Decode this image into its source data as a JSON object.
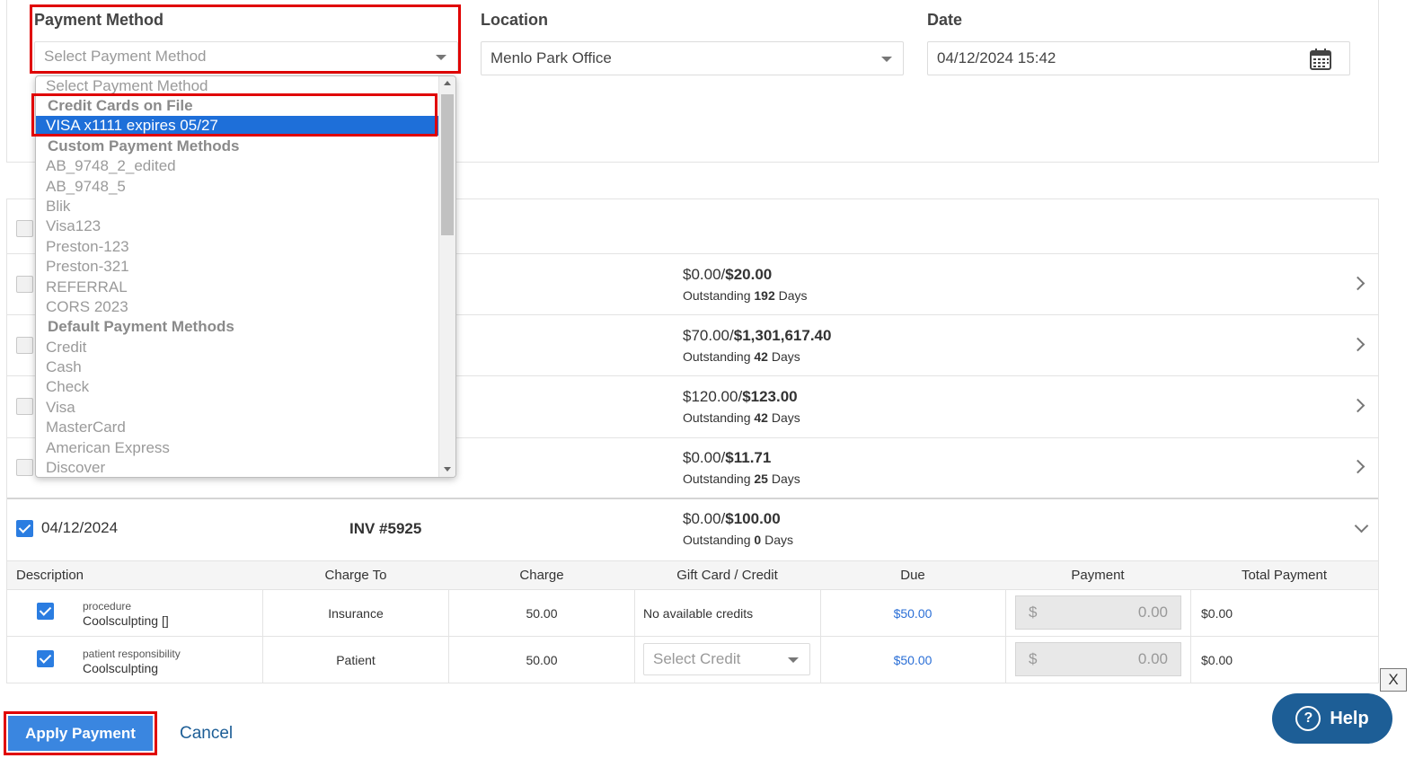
{
  "form": {
    "payment_method_label": "Payment Method",
    "payment_method_placeholder": "Select Payment Method",
    "location_label": "Location",
    "location_value": "Menlo Park Office",
    "date_label": "Date",
    "date_value": "04/12/2024 15:42"
  },
  "dropdown": {
    "placeholder": "Select Payment Method",
    "group_cards": "Credit Cards on File",
    "selected_option": "VISA x1111 expires 05/27",
    "group_custom": "Custom Payment Methods",
    "custom": [
      "AB_9748_2_edited",
      "AB_9748_5",
      "Blik",
      "Visa123",
      "Preston-123",
      "Preston-321",
      "REFERRAL",
      "CORS 2023"
    ],
    "group_default": "Default Payment Methods",
    "defaults": [
      "Credit",
      "Cash",
      "Check",
      "Visa",
      "MasterCard",
      "American Express",
      "Discover"
    ]
  },
  "invoices": [
    {
      "paid": "$0.00/",
      "total": "$20.00",
      "outstanding_prefix": "Outstanding",
      "days": "192",
      "days_suffix": "Days"
    },
    {
      "paid": "$70.00/",
      "total": "$1,301,617.40",
      "outstanding_prefix": "Outstanding",
      "days": "42",
      "days_suffix": "Days"
    },
    {
      "paid": "$120.00/",
      "total": "$123.00",
      "outstanding_prefix": "Outstanding",
      "days": "42",
      "days_suffix": "Days"
    },
    {
      "paid": "$0.00/",
      "total": "$11.71",
      "outstanding_prefix": "Outstanding",
      "days": "25",
      "days_suffix": "Days"
    }
  ],
  "expanded_invoice": {
    "date": "04/12/2024",
    "number": "INV #5925",
    "paid": "$0.00/",
    "total": "$100.00",
    "outstanding_prefix": "Outstanding",
    "days": "0",
    "days_suffix": "Days"
  },
  "table": {
    "headers": [
      "Description",
      "Charge To",
      "Charge",
      "Gift Card / Credit",
      "Due",
      "Payment",
      "Total Payment"
    ],
    "rows": [
      {
        "category": "procedure",
        "name": "Coolsculpting []",
        "charge_to": "Insurance",
        "charge": "50.00",
        "credit": "No available credits",
        "due": "$50.00",
        "currency": "$",
        "payment": "0.00",
        "total": "$0.00"
      },
      {
        "category": "patient responsibility",
        "name": "Coolsculpting",
        "charge_to": "Patient",
        "charge": "50.00",
        "credit": "Select Credit",
        "due": "$50.00",
        "currency": "$",
        "payment": "0.00",
        "total": "$0.00"
      }
    ]
  },
  "actions": {
    "apply": "Apply Payment",
    "cancel": "Cancel",
    "help": "Help",
    "help_glyph": "?",
    "close": "X"
  },
  "colors": {
    "accent": "#3a86e0",
    "highlight": "#e00000",
    "help": "#1d5e96",
    "due_link": "#2b6fd6"
  }
}
